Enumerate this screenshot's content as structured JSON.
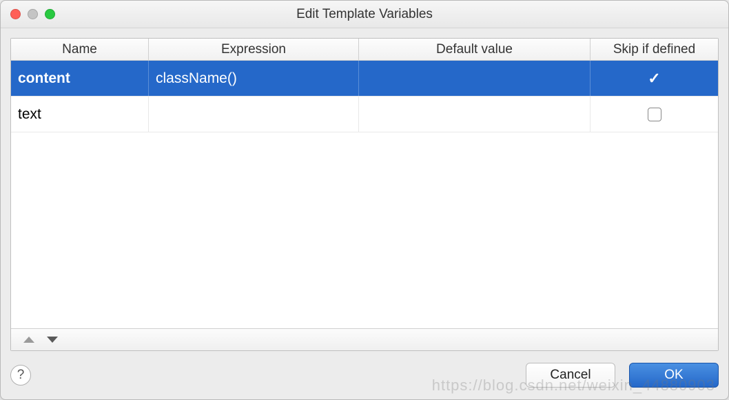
{
  "window": {
    "title": "Edit Template Variables"
  },
  "table": {
    "headers": {
      "name": "Name",
      "expression": "Expression",
      "default_value": "Default value",
      "skip_if_defined": "Skip if defined"
    },
    "rows": [
      {
        "name": "content",
        "expression": "className()",
        "default_value": "",
        "skip": true,
        "selected": true
      },
      {
        "name": "text",
        "expression": "",
        "default_value": "",
        "skip": false,
        "selected": false
      }
    ]
  },
  "footer": {
    "help_label": "?",
    "cancel_label": "Cancel",
    "ok_label": "OK"
  },
  "watermark": "https://blog.csdn.net/weixin_44880903"
}
